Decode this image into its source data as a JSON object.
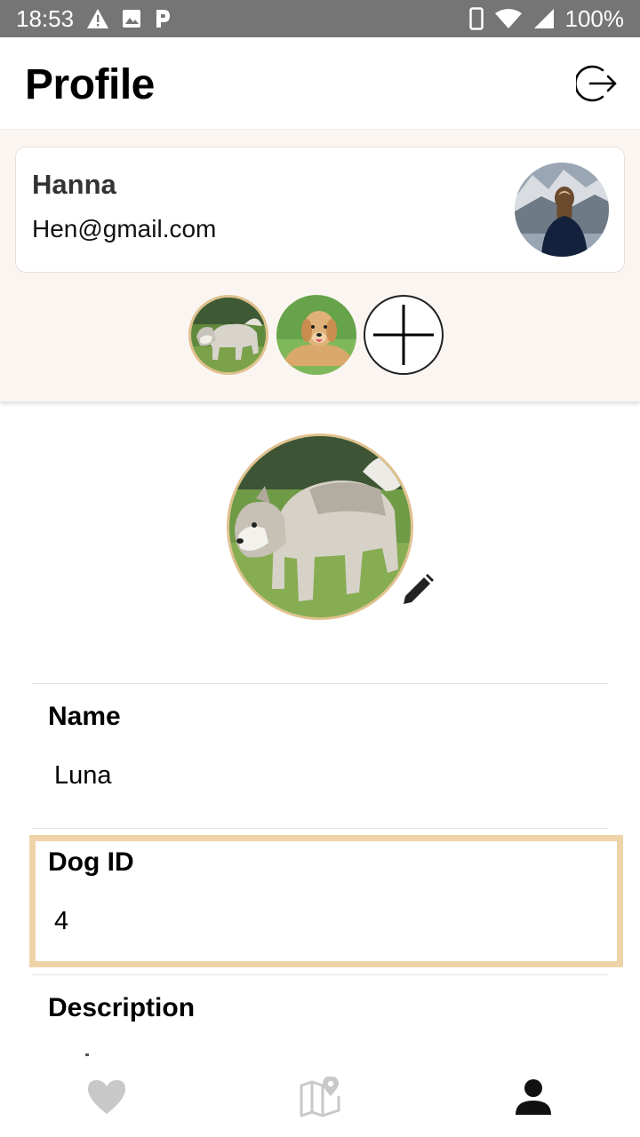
{
  "status_bar": {
    "time": "18:53",
    "battery": "100%",
    "icons": [
      "warning-icon",
      "image-icon",
      "parking-icon",
      "phone-icon",
      "wifi-icon",
      "signal-icon"
    ]
  },
  "header": {
    "title": "Profile",
    "logout_icon": "logout-icon"
  },
  "user": {
    "name": "Hanna",
    "email": "Hen@gmail.com"
  },
  "dogs": [
    {
      "id": "husky",
      "selected": true
    },
    {
      "id": "golden-retriever",
      "selected": false
    }
  ],
  "add_dog_icon": "plus-icon",
  "profile": {
    "fields": [
      {
        "label": "Name",
        "value": "Luna"
      },
      {
        "label": "Dog ID",
        "value": "4"
      },
      {
        "label": "Description",
        "value": ""
      }
    ]
  },
  "bottom_nav": {
    "items": [
      {
        "icon": "heart-icon",
        "active": false
      },
      {
        "icon": "map-pin-icon",
        "active": false
      },
      {
        "icon": "person-icon",
        "active": true
      }
    ]
  },
  "colors": {
    "status_bar": "#757575",
    "accent_border": "#e0c18d",
    "highlight_border": "#efd3a8",
    "section_bg": "#fbf5f2",
    "nav_inactive": "#c8c8c8",
    "nav_active": "#111111"
  }
}
